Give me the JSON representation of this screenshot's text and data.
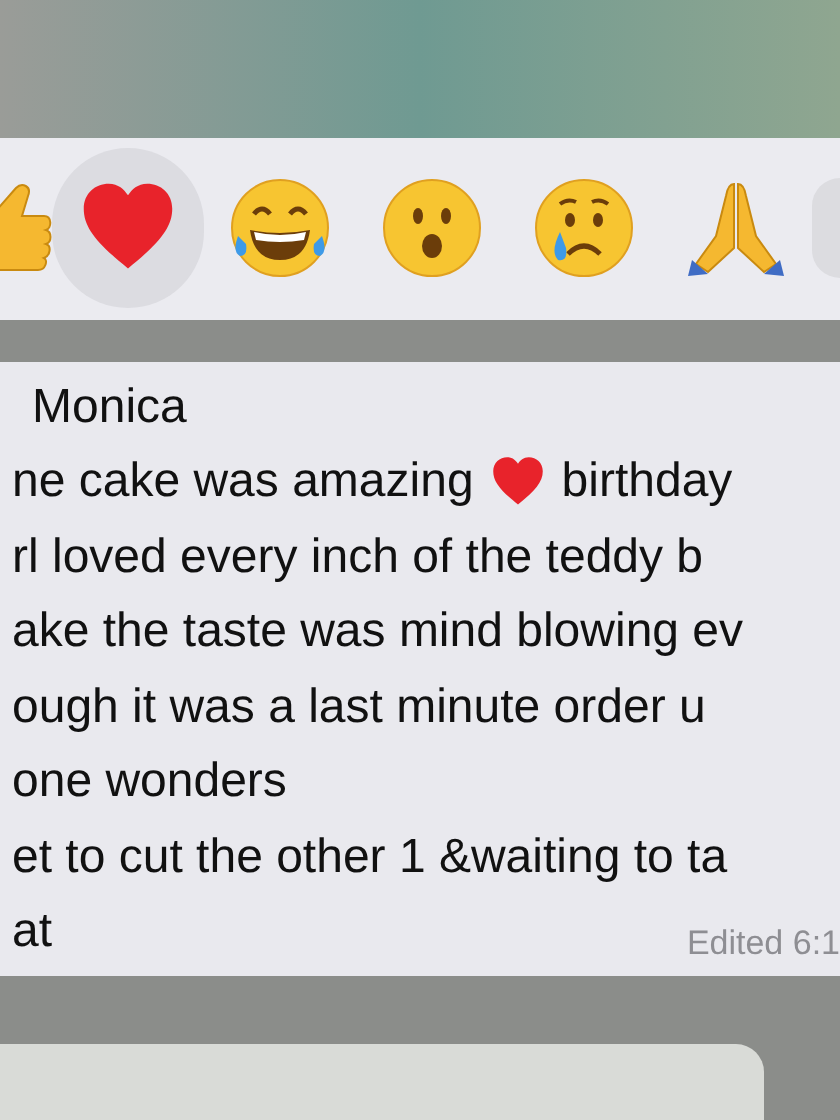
{
  "reaction_bar": {
    "reactions": [
      {
        "kind": "thumbs_up",
        "selected": false
      },
      {
        "kind": "heart",
        "selected": true
      },
      {
        "kind": "laughing",
        "selected": false
      },
      {
        "kind": "surprised",
        "selected": false
      },
      {
        "kind": "crying",
        "selected": false
      },
      {
        "kind": "praying",
        "selected": false
      },
      {
        "kind": "more",
        "selected": false
      }
    ]
  },
  "message": {
    "sender": "Monica",
    "lines": [
      [
        {
          "kind": "text",
          "text": "ne cake was amazing"
        },
        {
          "kind": "heart"
        },
        {
          "kind": "text",
          "text": "birthday"
        }
      ],
      [
        {
          "kind": "text",
          "text": "rl loved every inch of the teddy b"
        }
      ],
      [
        {
          "kind": "text",
          "text": "ake the taste was mind blowing ev"
        }
      ],
      [
        {
          "kind": "text",
          "text": "ough it was a last minute order u"
        }
      ],
      [
        {
          "kind": "text",
          "text": "one wonders"
        }
      ],
      [
        {
          "kind": "text",
          "text": "et to cut the other 1 &waiting to ta"
        }
      ],
      [
        {
          "kind": "text",
          "text": "at"
        }
      ]
    ],
    "status": "Edited 6:1"
  }
}
